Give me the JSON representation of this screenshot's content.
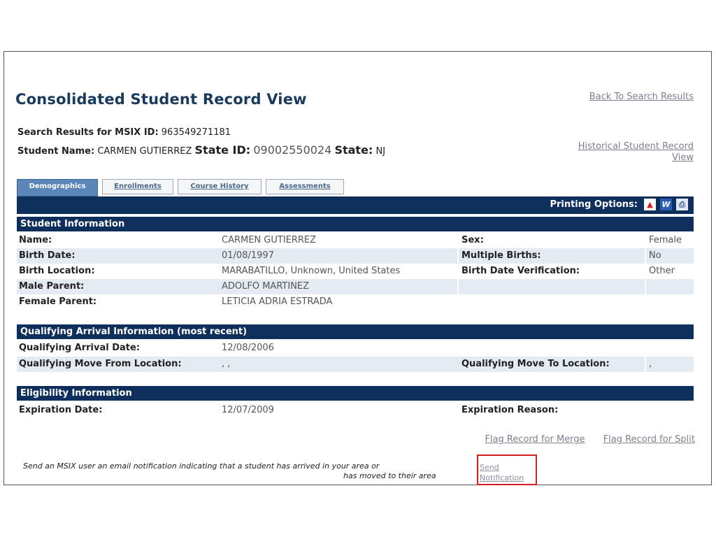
{
  "page": {
    "title": "Consolidated Student Record View",
    "back_link": "Back To Search Results",
    "historical_link_line1": "Historical Student Record",
    "historical_link_line2": "View"
  },
  "search": {
    "label": "Search Results for MSIX ID:",
    "msix_id": "963549271181"
  },
  "student": {
    "name_label": "Student Name:",
    "name": "CARMEN GUTIERREZ",
    "state_id_label": "State ID:",
    "state_id": "09002550024",
    "state_label": "State:",
    "state": "NJ"
  },
  "tabs": [
    {
      "label": "Demographics",
      "active": true
    },
    {
      "label": "Enrollments",
      "active": false
    },
    {
      "label": "Course History",
      "active": false
    },
    {
      "label": "Assessments",
      "active": false
    }
  ],
  "printing": {
    "label": "Printing Options:",
    "icons": [
      "pdf-icon",
      "word-icon",
      "print-icon"
    ]
  },
  "student_info": {
    "heading": "Student Information",
    "rows": [
      {
        "l1": "Name:",
        "v1": "CARMEN GUTIERREZ",
        "l2": "Sex:",
        "v2": "Female"
      },
      {
        "l1": "Birth Date:",
        "v1": "01/08/1997",
        "l2": "Multiple Births:",
        "v2": "No"
      },
      {
        "l1": "Birth Location:",
        "v1": "MARABATILLO, Unknown, United States",
        "l2": "Birth Date Verification:",
        "v2": "Other"
      },
      {
        "l1": "Male Parent:",
        "v1": "ADOLFO MARTINEZ",
        "l2": "",
        "v2": ""
      },
      {
        "l1": "Female Parent:",
        "v1": "LETICIA ADRIA ESTRADA",
        "l2": "",
        "v2": ""
      }
    ]
  },
  "arrival_info": {
    "heading": "Qualifying Arrival Information (most recent)",
    "rows": [
      {
        "l1": "Qualifying Arrival Date:",
        "v1": "12/08/2006",
        "l2": "",
        "v2": ""
      },
      {
        "l1": "Qualifying Move From Location:",
        "v1": ", ,",
        "l2": "Qualifying Move To Location:",
        "v2": ","
      }
    ]
  },
  "eligibility_info": {
    "heading": "Eligibility Information",
    "rows": [
      {
        "l1": "Expiration Date:",
        "v1": "12/07/2009",
        "l2": "Expiration Reason:",
        "v2": ""
      }
    ]
  },
  "flags": {
    "merge": "Flag Record for Merge",
    "split": "Flag Record for Split"
  },
  "notification": {
    "text_line1": "Send an MSIX user an email notification indicating that a student has arrived in your area or",
    "text_line2": "has moved to their area",
    "link_line1": "Send",
    "link_line2": "Notification",
    "highlight_color": "#d32020"
  }
}
